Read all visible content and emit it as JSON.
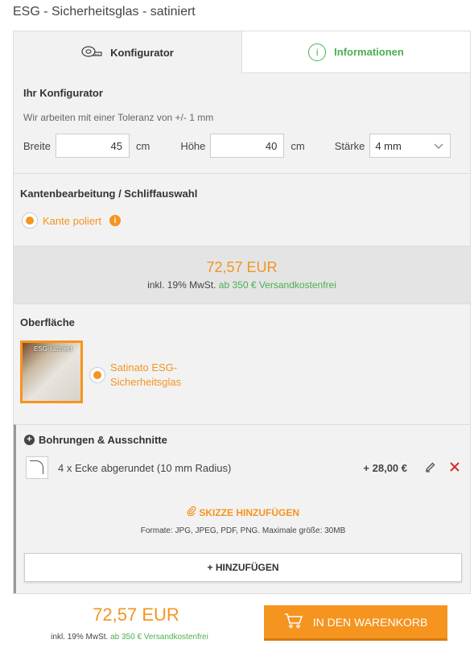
{
  "page": {
    "title": "ESG - Sicherheitsglas - satiniert"
  },
  "tabs": [
    {
      "label": "Konfigurator",
      "icon": "measuring-tape-icon"
    },
    {
      "label": "Informationen",
      "icon": "info-circle-icon"
    }
  ],
  "config": {
    "title": "Ihr Konfigurator",
    "tolerance": "Wir arbeiten mit einer Toleranz von +/- 1 mm",
    "width_label": "Breite",
    "width_value": "45",
    "width_unit": "cm",
    "height_label": "Höhe",
    "height_value": "40",
    "height_unit": "cm",
    "thickness_label": "Stärke",
    "thickness_value": "4 mm"
  },
  "edge": {
    "title": "Kantenbearbeitung / Schliffauswahl",
    "option": "Kante poliert"
  },
  "price": {
    "amount": "72,57 EUR",
    "vat": "inkl. 19% MwSt.",
    "shipping": "ab 350 € Versandkostenfrei"
  },
  "surface": {
    "title": "Oberfläche",
    "thumb_label": "ESG-satiniert",
    "option_line1": "Satinato ESG-",
    "option_line2": "Sicherheitsglas"
  },
  "drilling": {
    "title": "Bohrungen & Ausschnitte",
    "item_text": "4 x Ecke abgerundet (10 mm Radius)",
    "item_price": "+ 28,00 €",
    "sketch_label": "SKIZZE HINZUFÜGEN",
    "formats": "Formate: JPG, JPEG, PDF, PNG. Maximale größe: 30MB",
    "add_label": "+ HINZUFÜGEN"
  },
  "footer": {
    "amount": "72,57 EUR",
    "vat": "inkl. 19% MwSt.",
    "shipping": "ab 350 € Versandkostenfrei",
    "cart_label": "IN DEN WARENKORB"
  },
  "colors": {
    "accent": "#f5941f",
    "green": "#4caf50",
    "delete": "#d0302b"
  }
}
